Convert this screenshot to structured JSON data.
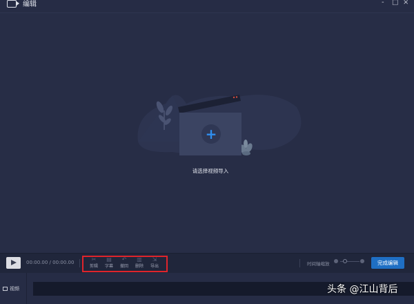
{
  "window": {
    "title": "编辑",
    "controls": {
      "minimize": "-",
      "maximize": "□",
      "close": "×"
    }
  },
  "stage": {
    "empty_hint": "请选择视频导入",
    "import_icon": "plus-icon",
    "import_symbol": "+"
  },
  "toolbar": {
    "timecode": "00:00.00 / 00:00.00",
    "tools": [
      {
        "label": "剪辑",
        "icon": "scissors-icon",
        "glyph": "✂"
      },
      {
        "label": "字幕",
        "icon": "subtitle-icon",
        "glyph": "▤"
      },
      {
        "label": "撤回",
        "icon": "undo-icon",
        "glyph": "↶"
      },
      {
        "label": "删除",
        "icon": "trash-icon",
        "glyph": "▥"
      },
      {
        "label": "导出",
        "icon": "export-icon",
        "glyph": "⇲"
      }
    ],
    "zoom_label": "时间轴缩放",
    "finish_label": "完成编辑"
  },
  "track": {
    "video_label": "视频"
  },
  "watermark": "头条 @江山背后",
  "colors": {
    "background": "#262c45",
    "accent": "#1f6fc4",
    "plus": "#2f8ff0",
    "highlight": "#e0242b"
  }
}
